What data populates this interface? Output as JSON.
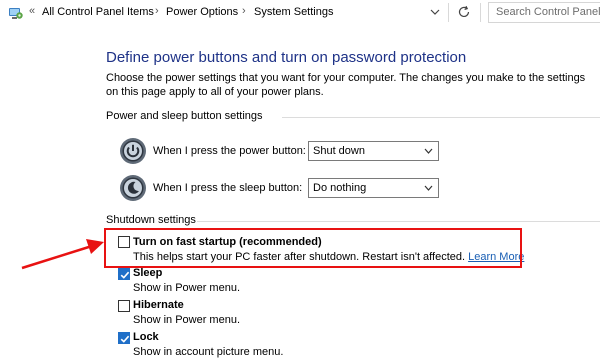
{
  "address_bar": {
    "breadcrumbs": [
      "All Control Panel Items",
      "Power Options",
      "System Settings"
    ],
    "search_placeholder": "Search Control Panel",
    "icons": [
      "control-panel-icon",
      "chevron-double-left-icon",
      "chevron-right-icon",
      "chevron-down-icon",
      "refresh-icon"
    ]
  },
  "main": {
    "title": "Define power buttons and turn on password protection",
    "description": "Choose the power settings that you want for your computer. The changes you make to the settings on this page apply to all of your power plans.",
    "power_group": {
      "label": "Power and sleep button settings",
      "rows": [
        {
          "label": "When I press the power button:",
          "value": "Shut down",
          "icon": "power-button-icon"
        },
        {
          "label": "When I press the sleep button:",
          "value": "Do nothing",
          "icon": "sleep-button-icon"
        }
      ]
    },
    "shutdown_group": {
      "label": "Shutdown settings",
      "options": [
        {
          "title": "Turn on fast startup (recommended)",
          "sub": "This helps start your PC faster after shutdown. Restart isn't affected.",
          "link": "Learn More",
          "checked": false
        },
        {
          "title": "Sleep",
          "sub": "Show in Power menu.",
          "checked": true
        },
        {
          "title": "Hibernate",
          "sub": "Show in Power menu.",
          "checked": false
        },
        {
          "title": "Lock",
          "sub": "Show in account picture menu.",
          "checked": true
        }
      ]
    }
  },
  "colors": {
    "title_blue": "#1e3287",
    "link_blue": "#1a5fb4",
    "checkbox_blue": "#1f6fc8",
    "highlight_red": "#e81212"
  }
}
